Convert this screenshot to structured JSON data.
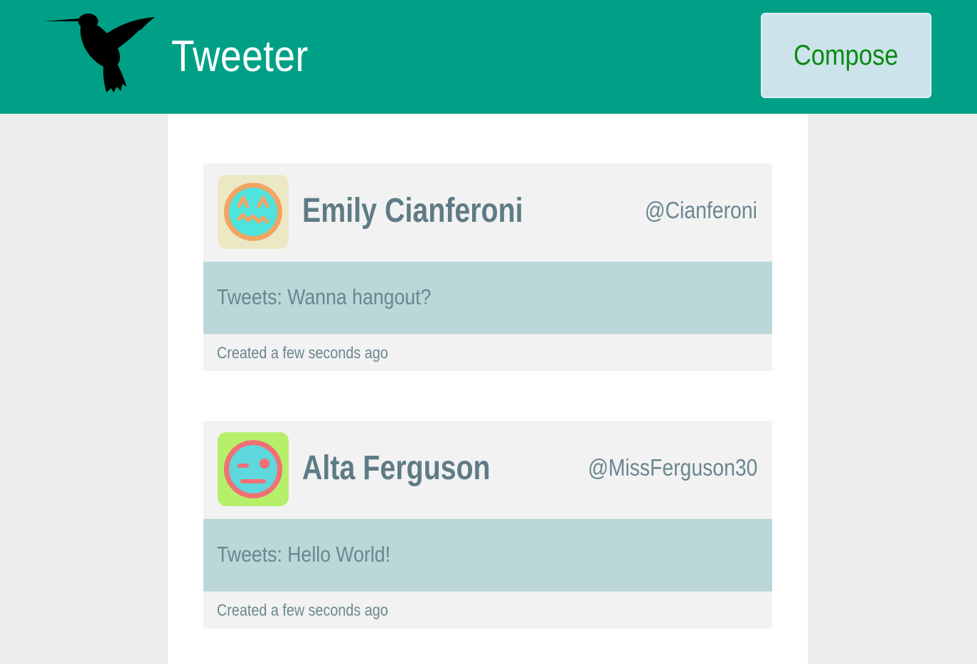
{
  "header": {
    "logo_icon": "hummingbird-icon",
    "title": "Tweeter",
    "compose_label": "Compose",
    "colors": {
      "bar": "#00a086",
      "compose_bg": "#cce3ec",
      "compose_text": "#0a8a10"
    }
  },
  "tweets": [
    {
      "avatar_icon": "face-icon-squint",
      "avatar_colors": {
        "bg": "#ece8c4",
        "ring": "#f2a463",
        "face": "#4fe3de"
      },
      "name": "Emily Cianferoni",
      "handle": "@Cianferoni",
      "text": "Tweets: Wanna hangout?",
      "created": "Created a few seconds ago"
    },
    {
      "avatar_icon": "face-icon-wink",
      "avatar_colors": {
        "bg": "#b6f06a",
        "ring": "#f26f74",
        "face": "#5ed8dc"
      },
      "name": "Alta Ferguson",
      "handle": "@MissFerguson30",
      "text": "Tweets: Hello World!",
      "created": "Created a few seconds ago"
    }
  ]
}
